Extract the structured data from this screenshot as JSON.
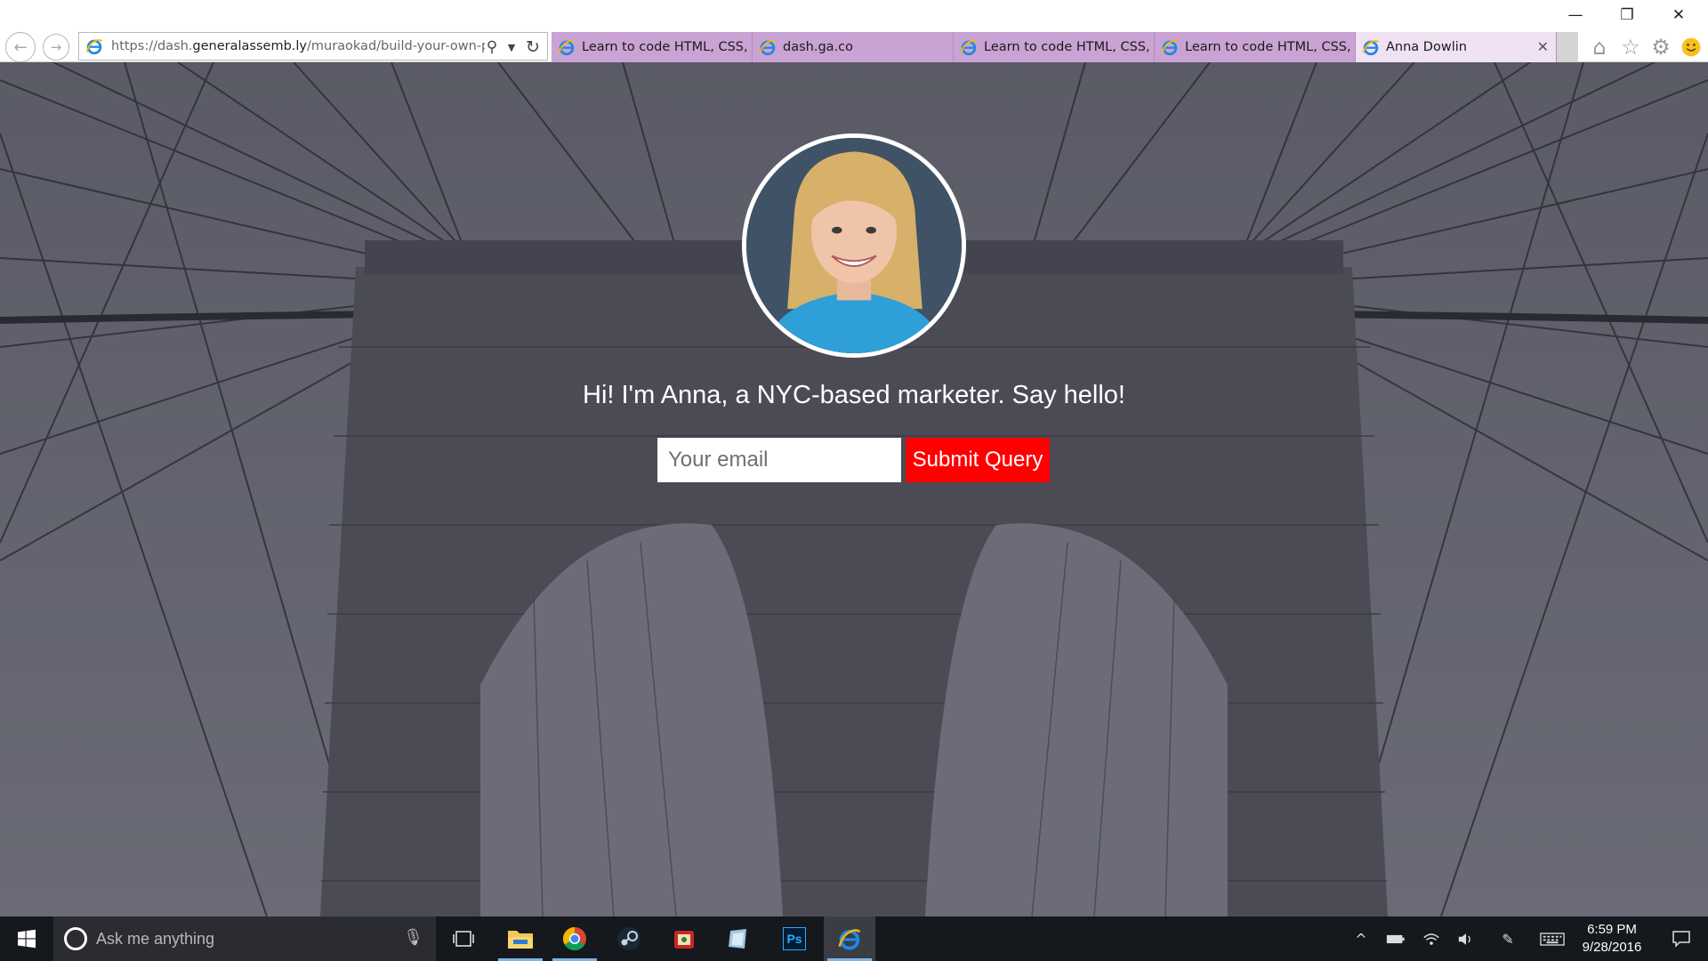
{
  "window": {
    "minimize_glyph": "—",
    "restore_glyph": "❐",
    "close_glyph": "✕"
  },
  "address_bar": {
    "url_prefix": "https://dash.",
    "url_domain": "generalassemb.ly",
    "url_path": "/muraokad/build-your-own-pers"
  },
  "tabs": [
    {
      "title": "Learn to code HTML, CSS, a..."
    },
    {
      "title": "dash.ga.co"
    },
    {
      "title": "Learn to code HTML, CSS, a..."
    },
    {
      "title": "Learn to code HTML, CSS, a..."
    },
    {
      "title": "Anna Dowlin",
      "active": true
    }
  ],
  "page": {
    "headline": "Hi! I'm Anna, a NYC-based marketer. Say hello!",
    "email_placeholder": "Your email",
    "submit_label": "Submit Query"
  },
  "taskbar": {
    "search_placeholder": "Ask me anything",
    "apps": [
      "file-explorer",
      "chrome",
      "steam",
      "game-app",
      "notes-app",
      "photoshop",
      "internet-explorer"
    ],
    "photoshop_label": "Ps",
    "time": "6:59 PM",
    "date": "9/28/2016"
  },
  "colors": {
    "tab_strip": "#c9a3d3",
    "active_tab": "#f0e1f3",
    "submit_button": "#ff0000",
    "overlay": "#5d5e6a",
    "taskbar": "#15181c"
  }
}
